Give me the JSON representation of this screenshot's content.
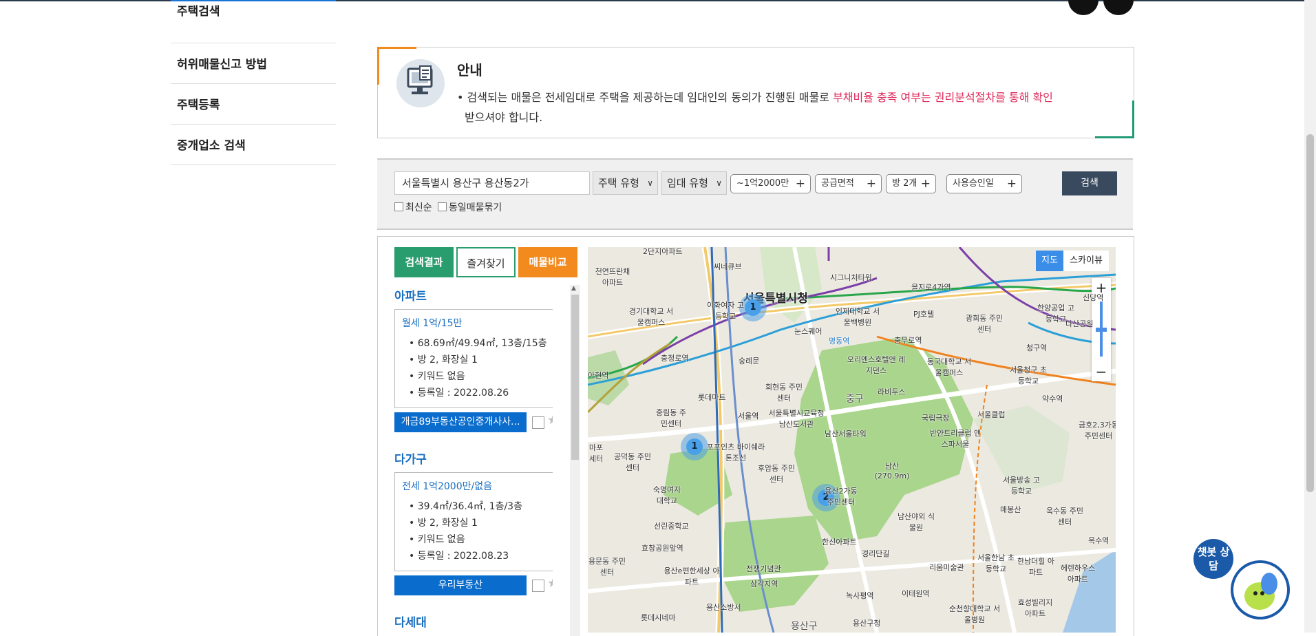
{
  "sidebar": {
    "items": [
      "주택검색",
      "허위매물신고 방법",
      "주택등록",
      "중개업소 검색"
    ]
  },
  "notice": {
    "title": "안내",
    "text_prefix": "• 검색되는 매물은 전세임대로 주택을 제공하는데 임대인의 동의가 진행된 매물로 ",
    "text_highlight": "부채비율 충족 여부는 권리분석절차를 통해 확인",
    "text_suffix": "받으셔야 합니다."
  },
  "search": {
    "address": "서울특별시 용산구 용산동2가",
    "house_type": "주택 유형",
    "rent_type": "임대 유형",
    "filters": [
      "~1억2000만",
      "공급면적",
      "방 2개",
      "사용승인일"
    ],
    "search_button": "검색",
    "checkbox_latest": "최신순",
    "checkbox_group": "동일매물묶기"
  },
  "tabs": [
    "검색결과",
    "즐겨찾기",
    "매물비교"
  ],
  "results": [
    {
      "category": "아파트",
      "price": "월세 1억/15만",
      "lines": [
        "68.69㎡/49.94㎡, 13층/15층",
        "방 2, 화장실 1",
        "키워드 없음",
        "등록일 : 2022.08.26"
      ],
      "agent": "개금89부동산공인중개사사..."
    },
    {
      "category": "다가구",
      "price": "전세 1억2000만/없음",
      "lines": [
        "39.4㎡/36.4㎡, 1층/3층",
        "방 2, 화장실 1",
        "키워드 없음",
        "등록일 : 2022.08.23"
      ],
      "agent": "우리부동산"
    },
    {
      "category": "다세대"
    }
  ],
  "map": {
    "type_map": "지도",
    "type_sky": "스카이뷰",
    "city_label": "서울특별시청",
    "clusters": [
      "1",
      "1",
      "2"
    ],
    "labels": [
      "2단지아파트",
      "천연뜨란채 아파트",
      "씨네큐브",
      "이화여자 고등학교",
      "경기대학교 서울캠퍼스",
      "시그니처타워",
      "인제대학교 서울백병원",
      "PJ호텔",
      "을지로4가역",
      "광희동 주민센터",
      "한양공업 고등학교",
      "신당역",
      "충정로역",
      "숭례문",
      "눈스퀘어",
      "명동역",
      "충무로역",
      "오리엔스호텔앤 레지던스",
      "동국대학교 서울캠퍼스",
      "청구역",
      "아현역",
      "회현동 주민센터",
      "롯데마트",
      "서울역",
      "중림동 주민센터",
      "서울특별시교육청 남산도서관",
      "라비두스",
      "국립극장",
      "서울클럽",
      "반얀트리클럽 앤스파서울",
      "약수역",
      "공덕동 주민센터",
      "포포인츠 바이쉐라톤조선",
      "후암동 주민센터",
      "남산서울타워",
      "남산 (270.9m)",
      "숙명여자 대학교",
      "선린중학교",
      "용산2가동 주민센터",
      "남산야외 식물원",
      "서울방송 고등학교",
      "매봉산",
      "옥수동 주민센터",
      "효창공원앞역",
      "한신아파트",
      "경리단길",
      "리움미술관",
      "서울한남 초등학교",
      "한남더힐 아파트",
      "헤렌하우스 아파트",
      "옥수역",
      "용문동 주민센터",
      "전쟁기념관",
      "용산e편한세상 아파트",
      "삼각지역",
      "녹사평역",
      "이태원역",
      "용산소방서",
      "롯데시네마",
      "용산구청",
      "순천향대학교 서울병원",
      "효성빌리지 아파트",
      "금호2,3가동 주민센터",
      "서울청구 초등학교",
      "다산공원",
      "마포 세터",
      "중구",
      "용산구"
    ]
  },
  "chatbot": {
    "label": "챗봇 상담"
  },
  "colors": {
    "accent_green": "#2a9d6f",
    "accent_orange": "#f28a1e",
    "highlight_red": "#e0285a",
    "link_blue": "#1a6fc0",
    "agent_blue": "#0a6ccc",
    "search_dark": "#3a4a5e"
  }
}
